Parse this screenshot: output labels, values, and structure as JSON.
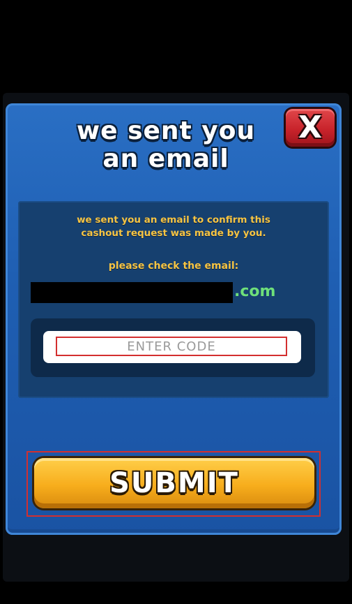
{
  "dialog": {
    "title_line1": "we sent you",
    "title_line2": "an email",
    "close_label": "X"
  },
  "info": {
    "message_line1": "we sent you an email to confirm this",
    "message_line2": "cashout request was made by you.",
    "check_label": "please check the email:",
    "email_domain": ".com"
  },
  "code_input": {
    "placeholder": "ENTER CODE",
    "value": ""
  },
  "submit": {
    "label": "SUBMIT"
  },
  "colors": {
    "panel_blue": "#1f5fb3",
    "text_gold": "#f6c443",
    "domain_green": "#6fe07a",
    "close_red": "#c8232b",
    "submit_orange": "#f7ad1c",
    "highlight_red": "#d32f2f"
  }
}
